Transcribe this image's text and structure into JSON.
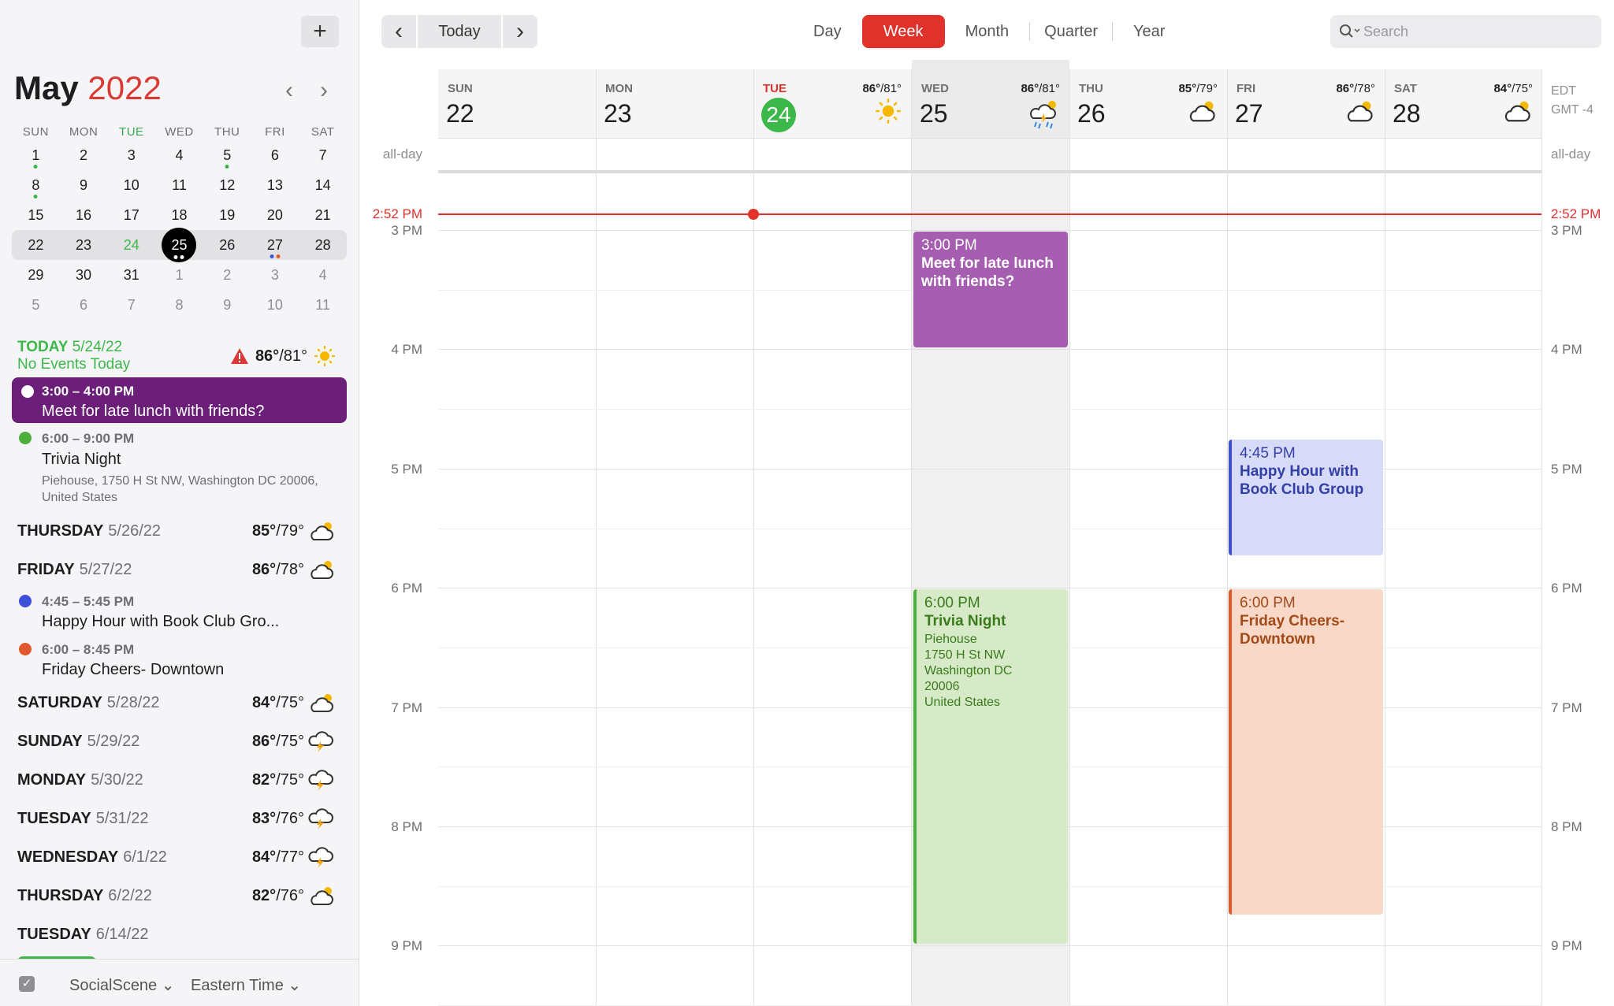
{
  "sidebar": {
    "add_label": "+",
    "mini_month": "May",
    "mini_year": "2022",
    "weekday_heads": [
      "SUN",
      "MON",
      "TUE",
      "WED",
      "THU",
      "FRI",
      "SAT"
    ],
    "weeks": [
      [
        "1",
        "2",
        "3",
        "4",
        "5",
        "6",
        "7"
      ],
      [
        "8",
        "9",
        "10",
        "11",
        "12",
        "13",
        "14"
      ],
      [
        "15",
        "16",
        "17",
        "18",
        "19",
        "20",
        "21"
      ],
      [
        "22",
        "23",
        "24",
        "25",
        "26",
        "27",
        "28"
      ],
      [
        "29",
        "30",
        "31",
        "1",
        "2",
        "3",
        "4"
      ],
      [
        "5",
        "6",
        "7",
        "8",
        "9",
        "10",
        "11"
      ]
    ],
    "today_label": "TODAY",
    "today_date": "5/24/22",
    "no_events": "No Events Today",
    "today_hi": "86°",
    "today_lo": "/81°",
    "agenda": {
      "lunch_time": "3:00 – 4:00 PM",
      "lunch_name": "Meet for late lunch with friends?",
      "trivia_time": "6:00 – 9:00 PM",
      "trivia_name": "Trivia Night",
      "trivia_loc": "Piehouse, 1750 H St NW, Washington DC 20006, United States",
      "hh_time": "4:45 – 5:45 PM",
      "hh_name": "Happy Hour with Book Club Gro...",
      "cheers_time": "6:00 – 8:45 PM",
      "cheers_name": "Friday Cheers- Downtown"
    },
    "days": [
      {
        "name": "THURSDAY",
        "date": "5/26/22",
        "hi": "85°",
        "lo": "/79°",
        "icon": "partly-cloudy-icon"
      },
      {
        "name": "FRIDAY",
        "date": "5/27/22",
        "hi": "86°",
        "lo": "/78°",
        "icon": "partly-cloudy-icon"
      },
      {
        "name": "SATURDAY",
        "date": "5/28/22",
        "hi": "84°",
        "lo": "/75°",
        "icon": "partly-cloudy-icon"
      },
      {
        "name": "SUNDAY",
        "date": "5/29/22",
        "hi": "86°",
        "lo": "/75°",
        "icon": "thunderstorm-icon"
      },
      {
        "name": "MONDAY",
        "date": "5/30/22",
        "hi": "82°",
        "lo": "/75°",
        "icon": "thunderstorm-icon"
      },
      {
        "name": "TUESDAY",
        "date": "5/31/22",
        "hi": "83°",
        "lo": "/76°",
        "icon": "thunderstorm-icon"
      },
      {
        "name": "WEDNESDAY",
        "date": "6/1/22",
        "hi": "84°",
        "lo": "/77°",
        "icon": "thunderstorm-icon"
      },
      {
        "name": "THURSDAY",
        "date": "6/2/22",
        "hi": "82°",
        "lo": "/76°",
        "icon": "partly-cloudy-icon"
      },
      {
        "name": "TUESDAY",
        "date": "6/14/22",
        "hi": "",
        "lo": "",
        "icon": ""
      }
    ],
    "footer_calendar": "SocialScene",
    "footer_timezone": "Eastern Time"
  },
  "toolbar": {
    "today_label": "Today",
    "views": [
      "Day",
      "Week",
      "Month",
      "Quarter",
      "Year"
    ],
    "active_view": "Week",
    "search_placeholder": "Search"
  },
  "week": {
    "columns": [
      {
        "dow": "SUN",
        "num": "22",
        "hi": "",
        "lo": "",
        "icon": ""
      },
      {
        "dow": "MON",
        "num": "23",
        "hi": "",
        "lo": "",
        "icon": ""
      },
      {
        "dow": "TUE",
        "num": "24",
        "hi": "86°",
        "lo": "/81°",
        "icon": "sun-icon"
      },
      {
        "dow": "WED",
        "num": "25",
        "hi": "86°",
        "lo": "/81°",
        "icon": "storm-rain-icon"
      },
      {
        "dow": "THU",
        "num": "26",
        "hi": "85°",
        "lo": "/79°",
        "icon": "partly-cloudy-icon"
      },
      {
        "dow": "FRI",
        "num": "27",
        "hi": "86°",
        "lo": "/78°",
        "icon": "partly-cloudy-icon"
      },
      {
        "dow": "SAT",
        "num": "28",
        "hi": "84°",
        "lo": "/75°",
        "icon": "partly-cloudy-icon"
      }
    ],
    "tz_left": "EDT",
    "tz_right": "GMT -4",
    "allday_label": "all-day",
    "current_time": "2:52 PM",
    "hours": [
      "3 PM",
      "4 PM",
      "5 PM",
      "6 PM",
      "7 PM",
      "8 PM",
      "9 PM"
    ],
    "events": {
      "lunch": {
        "time": "3:00 PM",
        "name": "Meet for late lunch with friends?"
      },
      "hh": {
        "time": "4:45 PM",
        "name": "Happy Hour with Book Club Group"
      },
      "trivia": {
        "time": "6:00 PM",
        "name": "Trivia Night",
        "loc": [
          "Piehouse",
          "1750 H St NW",
          "Washington DC",
          "20006",
          "United States"
        ]
      },
      "cheers": {
        "time": "6:00 PM",
        "name": "Friday Cheers- Downtown"
      }
    }
  },
  "colors": {
    "accent_red": "#e0312b",
    "today_green": "#3cb84a",
    "lunch_purple": "#a65fb0",
    "trivia_green": "#d7eac8",
    "hh_blue": "#d7dbf7",
    "cheers_peach": "#f9d8c8"
  }
}
